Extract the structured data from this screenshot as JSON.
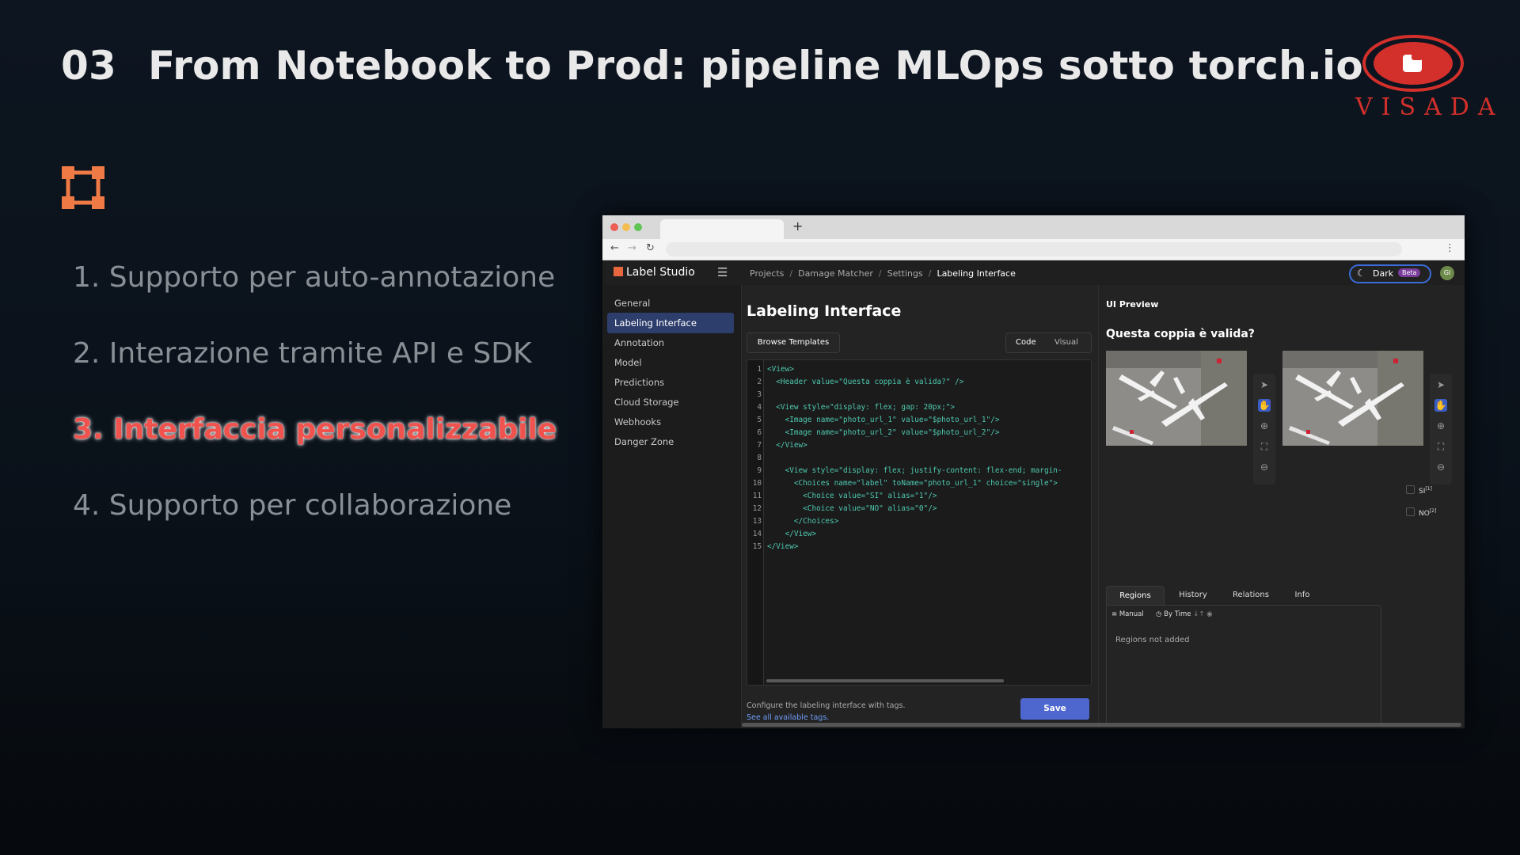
{
  "slide": {
    "number": "03",
    "title": "From Notebook to Prod: pipeline MLOps sotto torch.io",
    "logo_text": "VISADA",
    "bullets": [
      {
        "text": "1. Supporto per auto-annotazione",
        "active": false
      },
      {
        "text": "2. Interazione tramite API e SDK",
        "active": false
      },
      {
        "text": "3. Interfaccia personalizzabile",
        "active": true
      },
      {
        "text": "4. Supporto per collaborazione",
        "active": false
      }
    ],
    "accent_color": "#f0524d",
    "icon_color": "#ef7a45"
  },
  "browser": {
    "new_tab": "+",
    "app": {
      "brand": "Label Studio",
      "breadcrumb": [
        "Projects",
        "Damage Matcher",
        "Settings",
        "Labeling Interface"
      ],
      "theme_label": "Dark",
      "theme_badge": "Beta",
      "avatar_initials": "GI",
      "sidebar": [
        "General",
        "Labeling Interface",
        "Annotation",
        "Model",
        "Predictions",
        "Cloud Storage",
        "Webhooks",
        "Danger Zone"
      ],
      "sidebar_active_index": 1,
      "page_title": "Labeling Interface",
      "browse_templates": "Browse Templates",
      "view_toggle": {
        "code": "Code",
        "visual": "Visual"
      },
      "code_lines": [
        "<View>",
        "  <Header value=\"Questa coppia è valida?\" />",
        "",
        "  <View style=\"display: flex; gap: 20px;\">",
        "    <Image name=\"photo_url_1\" value=\"$photo_url_1\"/>",
        "    <Image name=\"photo_url_2\" value=\"$photo_url_2\"/>",
        "  </View>",
        "",
        "    <View style=\"display: flex; justify-content: flex-end; margin-",
        "      <Choices name=\"label\" toName=\"photo_url_1\" choice=\"single\">",
        "        <Choice value=\"SI\" alias=\"1\"/>",
        "        <Choice value=\"NO\" alias=\"0\"/>",
        "      </Choices>",
        "    </View>",
        "</View>"
      ],
      "config_hint": "Configure the labeling interface with tags.",
      "tags_link": "See all available tags.",
      "save": "Save",
      "preview": {
        "title": "UI Preview",
        "question": "Questa coppia è valida?",
        "choices": [
          {
            "label": "SI",
            "hotkey": "[1]"
          },
          {
            "label": "NO",
            "hotkey": "[2]"
          }
        ],
        "tabs": [
          "Regions",
          "History",
          "Relations",
          "Info"
        ],
        "filter_manual": "Manual",
        "filter_time": "By Time",
        "empty_message": "Regions not added"
      }
    }
  }
}
